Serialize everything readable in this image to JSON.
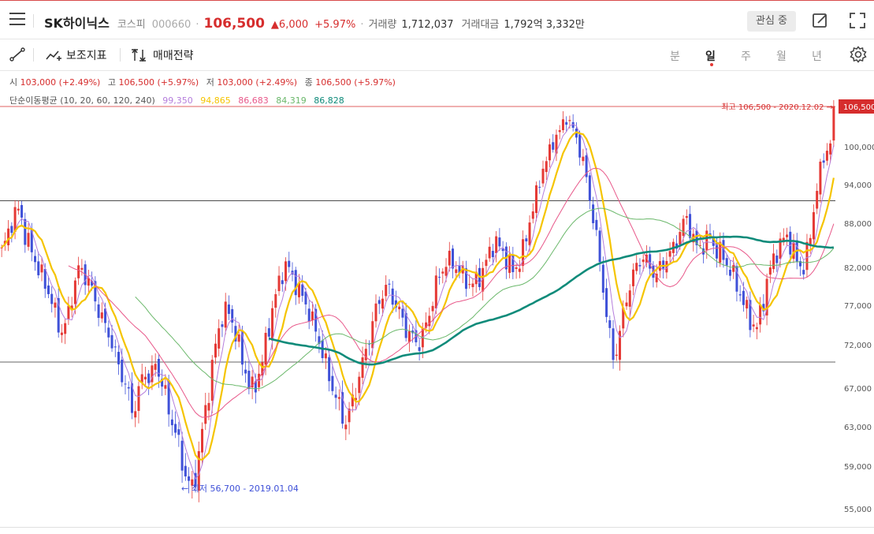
{
  "header": {
    "stock_name": "SK하이닉스",
    "market": "코스피",
    "code": "000660",
    "separator": "·",
    "price": "106,500",
    "change": "▲6,000",
    "change_pct": "+5.97%",
    "volume_label": "거래량",
    "volume": "1,712,037",
    "amount_label": "거래대금",
    "amount": "1,792억 3,332만",
    "watch_label": "관심 중"
  },
  "toolbar": {
    "indicator_label": "보조지표",
    "strategy_label": "매매전략",
    "periods": [
      "분",
      "일",
      "주",
      "월",
      "년"
    ],
    "active_period": "일"
  },
  "ohlc": {
    "open_label": "시",
    "open": "103,000 (+2.49%)",
    "high_label": "고",
    "high": "106,500 (+5.97%)",
    "low_label": "저",
    "low": "103,000 (+2.49%)",
    "close_label": "종",
    "close": "106,500 (+5.97%)"
  },
  "ma": {
    "label": "단순이동평균 (10, 20, 60, 120, 240)",
    "values": [
      "99,350",
      "94,865",
      "86,683",
      "84,319",
      "86,828"
    ],
    "colors": [
      "#b57edc",
      "#f5c400",
      "#e8588a",
      "#6bb86b",
      "#0f8b7a"
    ]
  },
  "colors": {
    "up": "#e53935",
    "down": "#3f51d8",
    "accent": "#d62d2d"
  },
  "chart_data": {
    "type": "candlestick",
    "y_axis_ticks": [
      "106,500",
      "100,000",
      "94,000",
      "88,000",
      "82,000",
      "77,000",
      "72,000",
      "67,000",
      "63,000",
      "59,000",
      "55,000"
    ],
    "ylim": [
      53500,
      109000
    ],
    "current_price_label": "106,500",
    "high_annotation": "최고 106,500 - 2020.12.02 →",
    "low_annotation": "← 최저 56,700 - 2019.01.04",
    "reference_lines": [
      91500,
      70000
    ],
    "close_series": [
      84000,
      86500,
      89000,
      90500,
      86000,
      84500,
      82000,
      80500,
      78500,
      76000,
      73500,
      75000,
      79000,
      82000,
      81000,
      79500,
      77000,
      75000,
      73500,
      71000,
      69000,
      67000,
      64500,
      66500,
      69000,
      68000,
      70000,
      67500,
      65000,
      63000,
      60500,
      58000,
      56700,
      59500,
      63500,
      67500,
      72000,
      75500,
      76500,
      74500,
      71500,
      69000,
      66500,
      68000,
      70500,
      74500,
      78000,
      81000,
      82500,
      80500,
      79000,
      77500,
      75500,
      73500,
      71000,
      68500,
      66500,
      64500,
      63500,
      65500,
      68000,
      70500,
      73500,
      76500,
      78500,
      79500,
      77500,
      76000,
      74000,
      73000,
      72000,
      73500,
      76000,
      79500,
      81500,
      83000,
      82500,
      81500,
      80500,
      79500,
      80500,
      81500,
      84000,
      85500,
      84500,
      83000,
      81500,
      82500,
      85000,
      89000,
      92500,
      96500,
      98500,
      101500,
      102500,
      105000,
      103000,
      100500,
      97000,
      91500,
      86500,
      80500,
      74500,
      70000,
      73500,
      77500,
      80500,
      82500,
      83500,
      82000,
      81000,
      82000,
      83500,
      84500,
      86500,
      89000,
      87000,
      84500,
      85000,
      86500,
      84500,
      84000,
      82500,
      81000,
      79000,
      77000,
      75000,
      74000,
      77000,
      81000,
      83500,
      85000,
      86500,
      84500,
      82500,
      82000,
      86000,
      92500,
      97500,
      100000,
      101000
    ]
  }
}
